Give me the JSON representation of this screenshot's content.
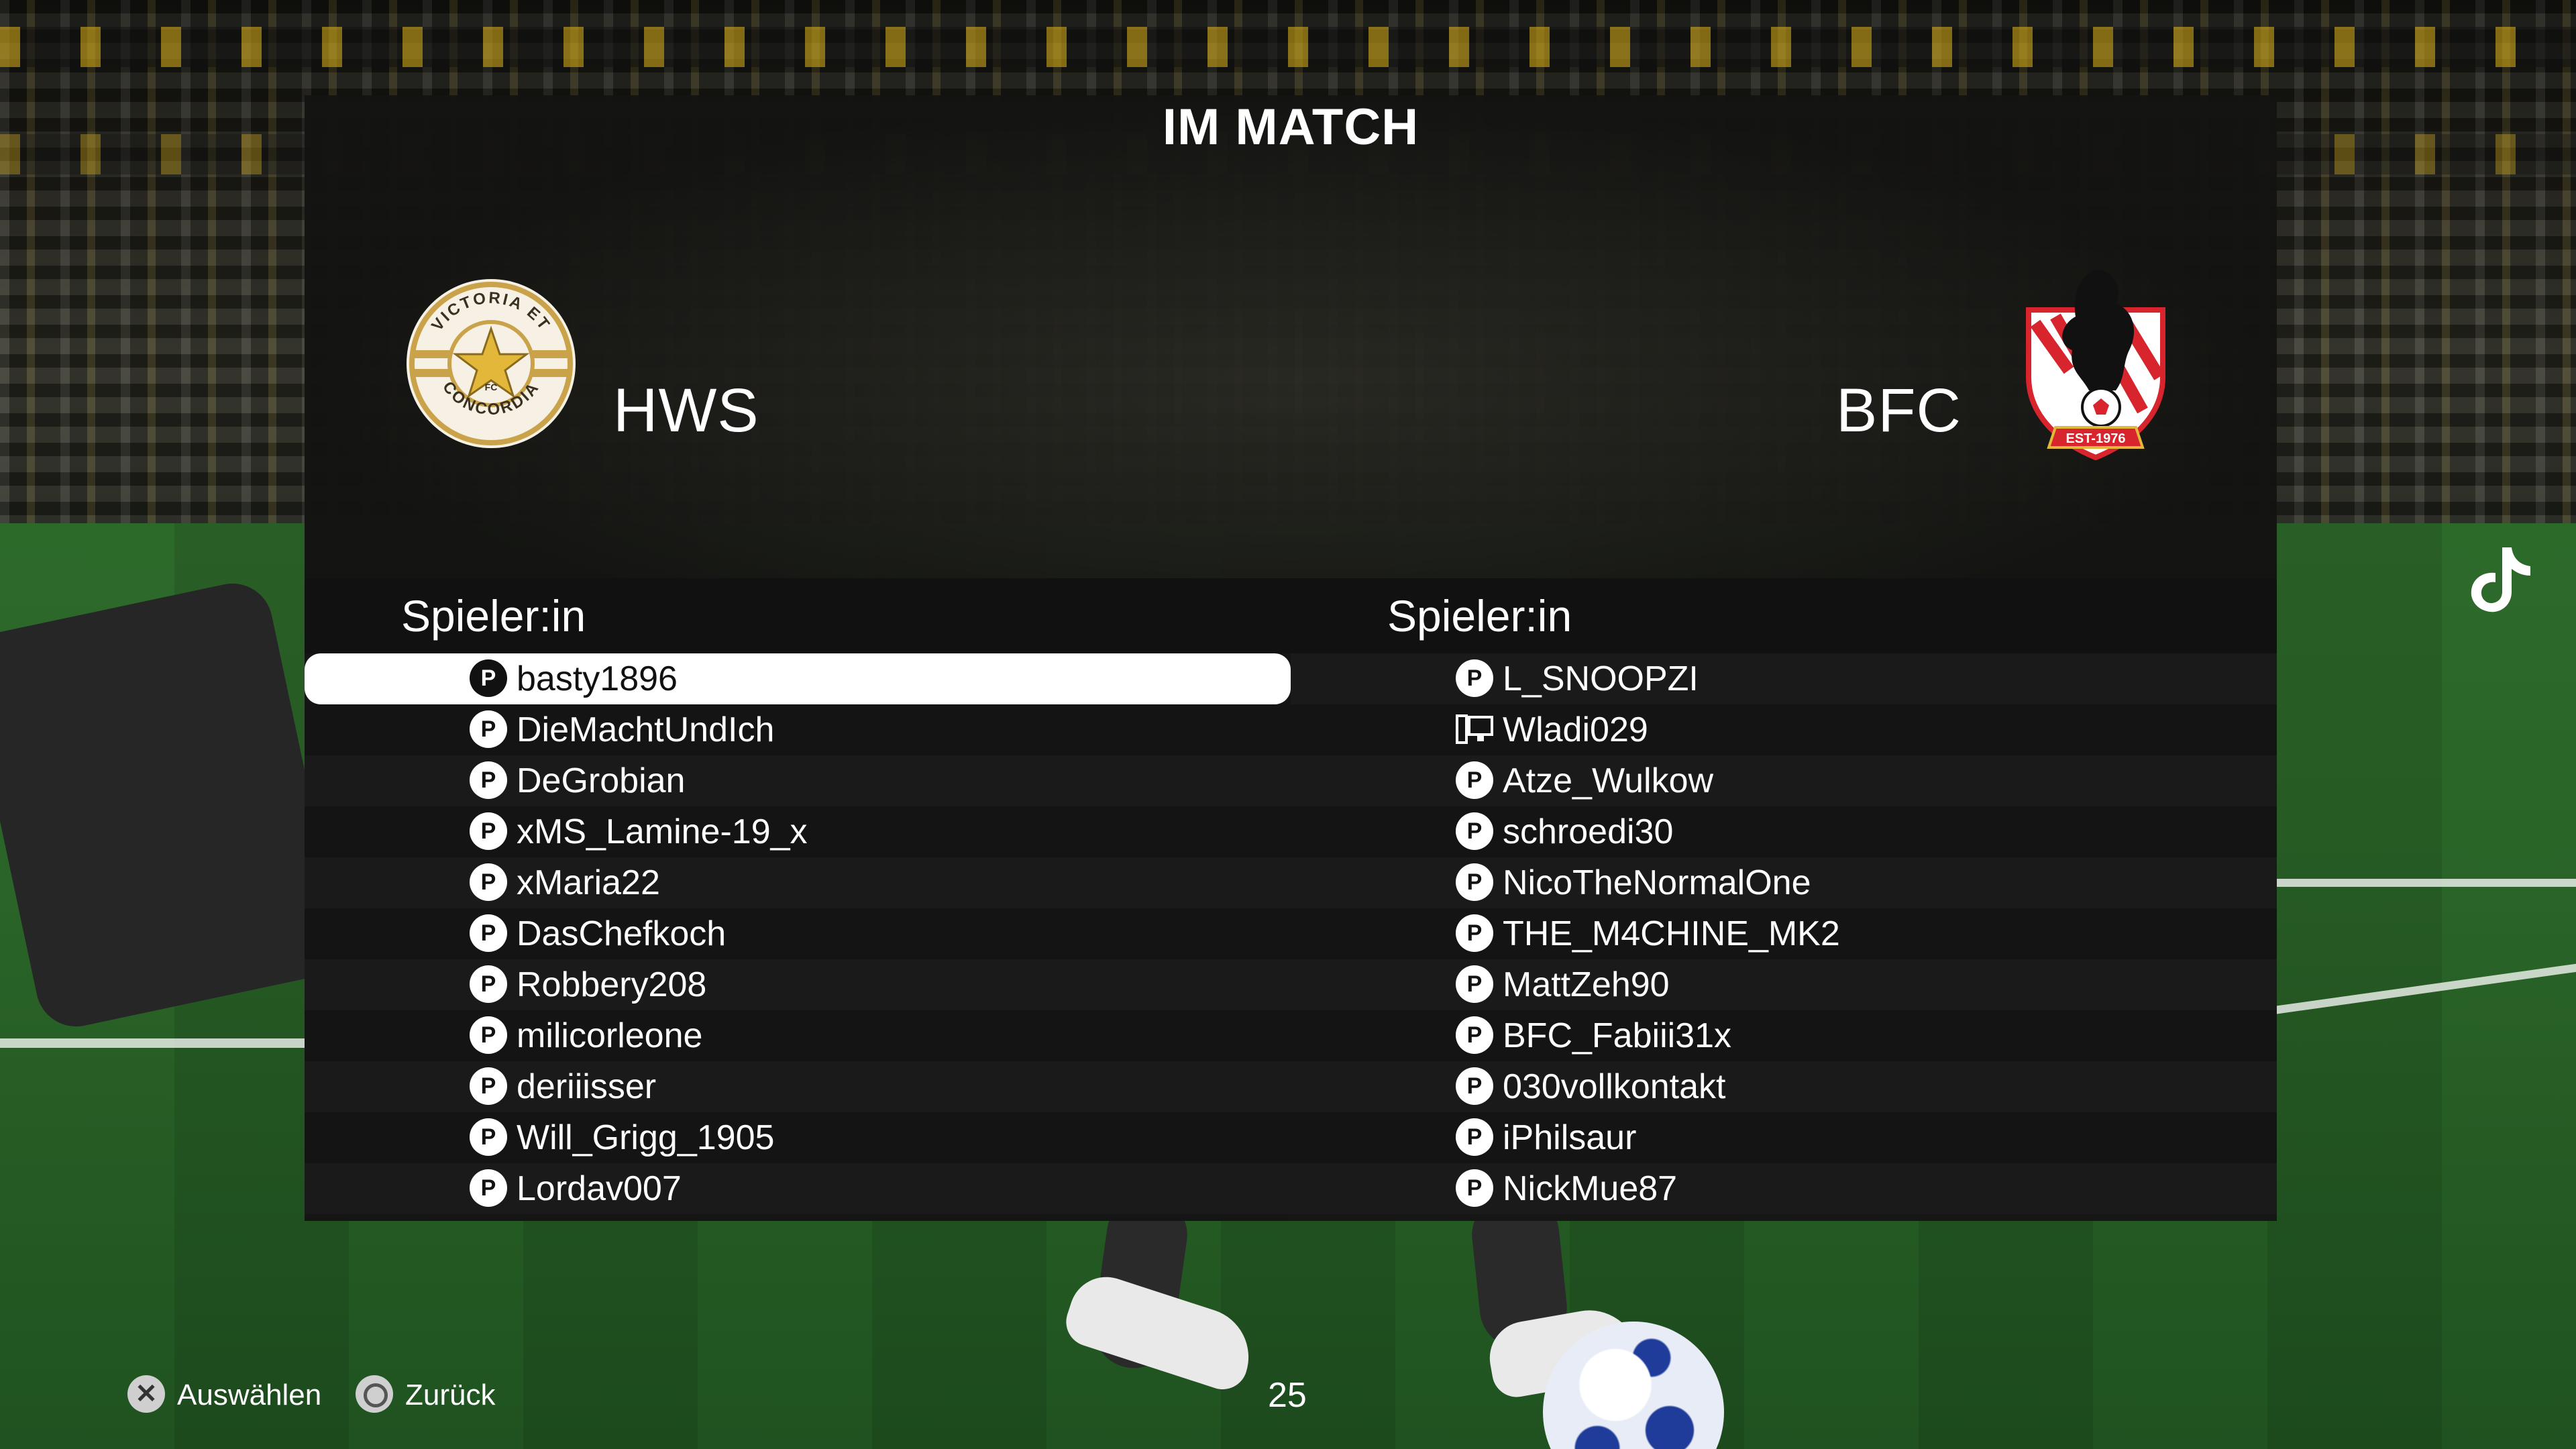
{
  "screen": {
    "title": "IM MATCH"
  },
  "home": {
    "logo_text": [
      "VICTORIA ET",
      "FC",
      "CONCORDIA"
    ],
    "name": "HWS",
    "column_header": "Spieler:in",
    "players": [
      {
        "name": "basty1896",
        "platform": "playstation",
        "selected": true
      },
      {
        "name": "DieMachtUndIch",
        "platform": "playstation",
        "selected": false
      },
      {
        "name": "DeGrobian",
        "platform": "playstation",
        "selected": false
      },
      {
        "name": "xMS_Lamine-19_x",
        "platform": "playstation",
        "selected": false
      },
      {
        "name": "xMaria22",
        "platform": "playstation",
        "selected": false
      },
      {
        "name": "DasChefkoch",
        "platform": "playstation",
        "selected": false
      },
      {
        "name": "Robbery208",
        "platform": "playstation",
        "selected": false
      },
      {
        "name": "milicorleone",
        "platform": "playstation",
        "selected": false
      },
      {
        "name": "deriiisser",
        "platform": "playstation",
        "selected": false
      },
      {
        "name": "Will_Grigg_1905",
        "platform": "playstation",
        "selected": false
      },
      {
        "name": "Lordav007",
        "platform": "playstation",
        "selected": false
      }
    ]
  },
  "away": {
    "logo_text": "EST-1976",
    "name": "BFC",
    "column_header": "Spieler:in",
    "players": [
      {
        "name": "L_SNOOPZI",
        "platform": "playstation"
      },
      {
        "name": "Wladi029",
        "platform": "pc"
      },
      {
        "name": "Atze_Wulkow",
        "platform": "playstation"
      },
      {
        "name": "schroedi30",
        "platform": "playstation"
      },
      {
        "name": "NicoTheNormalOne",
        "platform": "playstation"
      },
      {
        "name": "THE_M4CHINE_MK2",
        "platform": "playstation"
      },
      {
        "name": "MattZeh90",
        "platform": "playstation"
      },
      {
        "name": "BFC_Fabiii31x",
        "platform": "playstation"
      },
      {
        "name": "030vollkontakt",
        "platform": "playstation"
      },
      {
        "name": "iPhilsaur",
        "platform": "playstation"
      },
      {
        "name": "NickMue87",
        "platform": "playstation"
      }
    ]
  },
  "footer": {
    "select_label": "Auswählen",
    "back_label": "Zurück",
    "counter": "25"
  },
  "icons": {
    "platform_playstation": "playstation-icon",
    "platform_pc": "pc-icon",
    "select_button": "cross-button-icon",
    "back_button": "circle-button-icon",
    "tiktok": "tiktok-icon"
  },
  "colors": {
    "home_logo_gold": "#c9a24a",
    "away_logo_red": "#d8242c",
    "selected_row": "#ffffff",
    "panel": "#151515"
  }
}
